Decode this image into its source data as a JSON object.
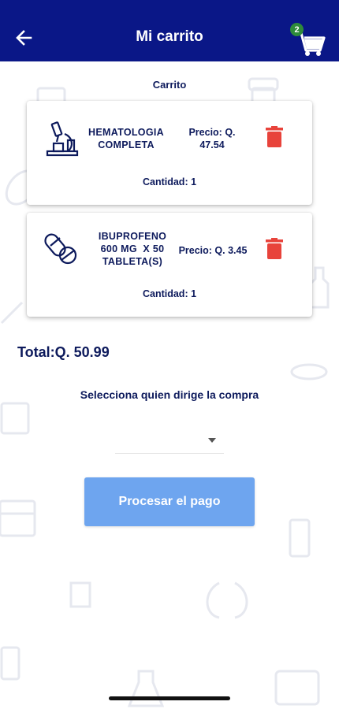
{
  "header": {
    "title": "Mi carrito",
    "cart_count": "2",
    "back_icon": "arrow-left-icon",
    "cart_icon": "shopping-cart-icon"
  },
  "section_label": "Carrito",
  "items": [
    {
      "icon": "microscope-icon",
      "name_line1": "HEMATOLOGIA",
      "name_line2": "COMPLETA",
      "price_line1": "Precio: Q.",
      "price_line2": "47.54",
      "quantity": "Cantidad: 1"
    },
    {
      "icon": "pills-icon",
      "name_line1": "IBUPROFENO",
      "name_line2": "600 MG  X 50",
      "name_line3": "TABLETA(S)",
      "price": "Precio: Q. 3.45",
      "quantity": "Cantidad: 1"
    }
  ],
  "total": "Total:Q. 50.99",
  "select_label": "Selecciona quien dirige la compra",
  "dropdown_value": "",
  "pay_button": "Procesar el pago",
  "colors": {
    "header_bg": "#0a1787",
    "text_primary": "#0d1a5c",
    "delete_red": "#e8433b",
    "badge_green": "#2e8b3a",
    "button_blue": "#6ea5ef"
  }
}
